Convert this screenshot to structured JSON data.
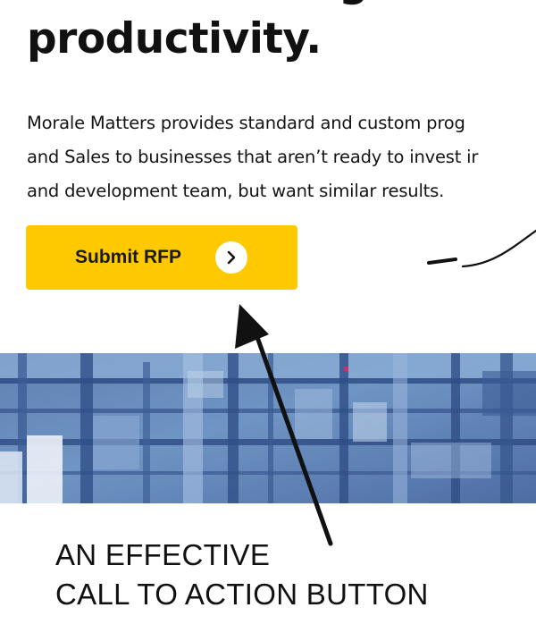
{
  "hero": {
    "headline_lines": [
      "while boosting efficie",
      "productivity."
    ],
    "body_lines": [
      "Morale Matters provides standard and custom prog",
      "and Sales to businesses that aren’t ready to invest ir",
      "and development team, but want similar results."
    ],
    "cta": {
      "label": "Submit RFP",
      "icon": "chevron-right-icon",
      "background": "#ffc900",
      "text_color": "#1a1a1a"
    }
  },
  "annotation": {
    "caption_lines": [
      "AN EFFECTIVE",
      "CALL TO ACTION BUTTON"
    ]
  }
}
